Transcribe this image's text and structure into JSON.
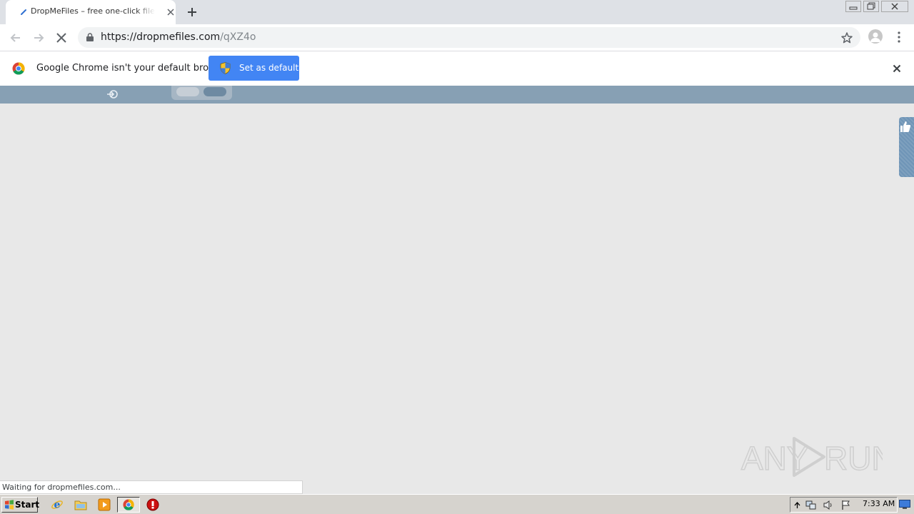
{
  "browser": {
    "tab": {
      "title": "DropMeFiles – free one-click file sharing service",
      "close_icon": "close-icon"
    },
    "new_tab_icon": "plus-icon",
    "window_controls": [
      "minimize-icon",
      "restore-icon",
      "close-icon"
    ],
    "toolbar": {
      "back_icon": "arrow-left-icon",
      "forward_icon": "arrow-right-icon",
      "stop_icon": "close-icon",
      "url_host": "https://dropmefiles.com",
      "url_path": "/qXZ4o",
      "bookmark_icon": "star-icon",
      "profile_icon": "avatar-icon",
      "menu_icon": "vertical-dots-icon"
    },
    "infobar": {
      "message": "Google Chrome isn't your default browser",
      "button_label": "Set as default",
      "button_color": "#4285f4"
    },
    "status_text": "Waiting for dropmefiles.com..."
  },
  "page": {
    "header_color": "#87a0b4",
    "background_color": "#e8e8e8",
    "icons": [
      "login-icon",
      "thumbs-up-icon"
    ]
  },
  "watermark": {
    "text_left": "ANY",
    "text_right": "RUN"
  },
  "taskbar": {
    "start_label": "Start",
    "clock": "7:33 AM",
    "pinned_icons": [
      "ie-icon",
      "folder-icon",
      "media-player-icon",
      "chrome-icon",
      "stop-icon"
    ],
    "tray_icons": [
      "chevron-up-icon",
      "network-icon",
      "volume-icon",
      "flag-icon"
    ]
  }
}
